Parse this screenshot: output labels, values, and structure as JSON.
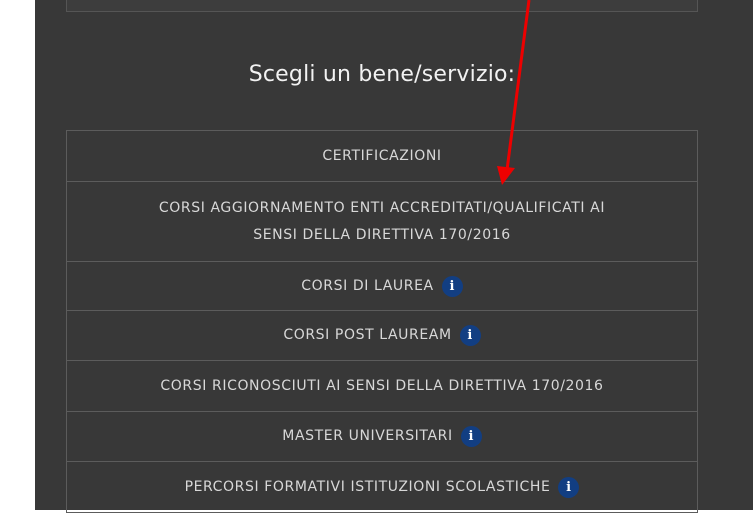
{
  "heading": "Scegli un bene/servizio:",
  "items": [
    {
      "label": "CERTIFICAZIONI",
      "info": false
    },
    {
      "label": "CORSI AGGIORNAMENTO ENTI ACCREDITATI/QUALIFICATI AI",
      "label_line2": "SENSI DELLA DIRETTIVA 170/2016",
      "info": false
    },
    {
      "label": "CORSI DI LAUREA",
      "info": true
    },
    {
      "label": "CORSI POST LAUREAM",
      "info": true
    },
    {
      "label": "CORSI RICONOSCIUTI AI SENSI DELLA DIRETTIVA 170/2016",
      "info": false
    },
    {
      "label": "MASTER UNIVERSITARI",
      "info": true
    },
    {
      "label": "PERCORSI FORMATIVI ISTITUZIONI SCOLASTICHE",
      "info": true
    }
  ],
  "info_icon_glyph": "i",
  "colors": {
    "panel_bg": "#383838",
    "border": "#5c5c5c",
    "text": "#d8d8d8",
    "info_icon_bg": "#123e82",
    "arrow": "#ee0000"
  },
  "annotation": {
    "icon": "red-arrow-icon"
  }
}
